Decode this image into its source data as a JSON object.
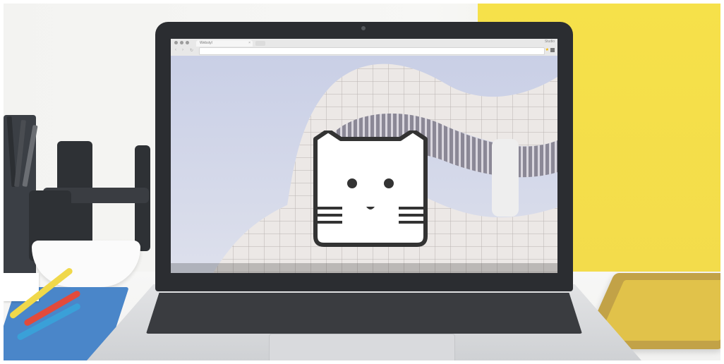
{
  "scene": {
    "description_tags": [
      "laptop-mockup",
      "desk",
      "browser-window",
      "cat-logo"
    ],
    "colors": {
      "wall_yellow": "#f3dc4b",
      "laptop_bezel": "#2b2d31",
      "cat_outline": "#333333",
      "cat_fill": "#ffffff",
      "notebook_blue": "#4a86c9",
      "tablet_gold": "#c2a247"
    }
  },
  "browser": {
    "tab_label": "Webstyl",
    "tab_close": "×",
    "profile_label": "Studio",
    "back_glyph": "‹",
    "forward_glyph": "›",
    "reload_glyph": "↻",
    "star_glyph": "★"
  },
  "icons": {
    "cat_logo": "cat-face-icon"
  }
}
